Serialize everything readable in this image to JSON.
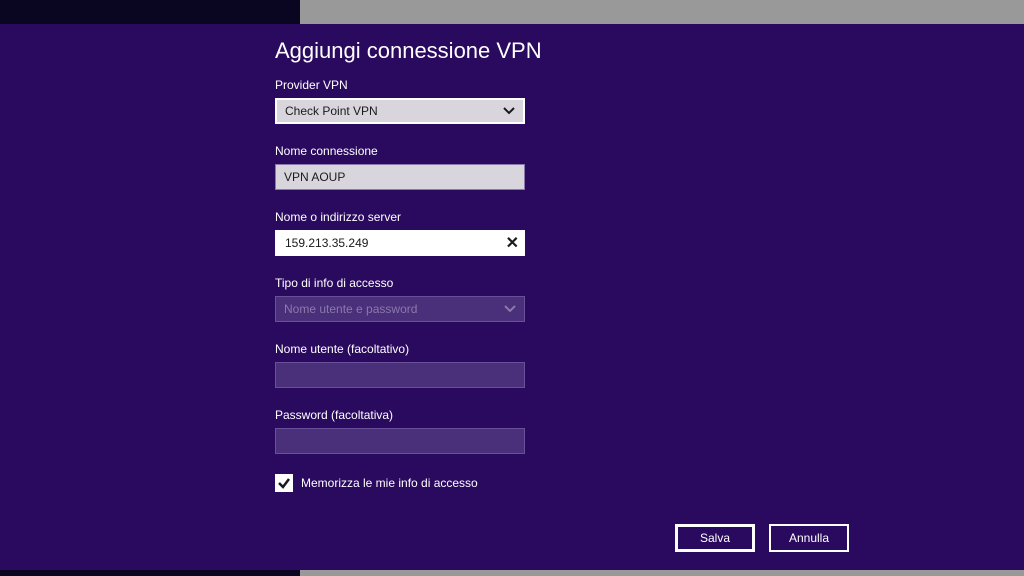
{
  "dialog": {
    "title": "Aggiungi connessione VPN",
    "provider": {
      "label": "Provider VPN",
      "value": "Check Point VPN"
    },
    "connection_name": {
      "label": "Nome connessione",
      "value": "VPN AOUP"
    },
    "server": {
      "label": "Nome o indirizzo server",
      "value": "159.213.35.249"
    },
    "signin_type": {
      "label": "Tipo di info di accesso",
      "value": "Nome utente e password"
    },
    "username": {
      "label": "Nome utente (facoltativo)",
      "value": ""
    },
    "password": {
      "label": "Password (facoltativa)",
      "value": ""
    },
    "remember": {
      "label": "Memorizza le mie info di accesso",
      "checked": true
    },
    "buttons": {
      "save": "Salva",
      "cancel": "Annulla"
    }
  }
}
